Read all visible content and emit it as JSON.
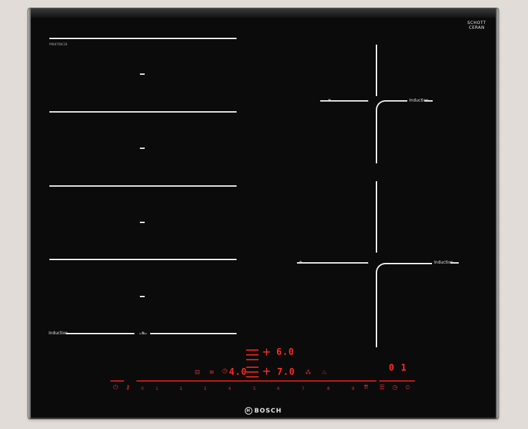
{
  "brand_name": "BOSCH",
  "glass_brand": {
    "line1": "SCHOTT",
    "line2": "CERAN"
  },
  "model_code": "PXE675DC1E",
  "zones": {
    "left_label": "Induction",
    "left_flex_label": "ᴗᴓᴗ",
    "right_top_label": "Induction",
    "right_top_flex": "ᴗᴓᴗ",
    "right_bottom_label": "Induction",
    "right_bottom_flex": "ᴗᴓᴗ"
  },
  "displays": {
    "center_top": "6.0",
    "center_left": "4.0",
    "center_right": "7.0",
    "timer": "0 1"
  },
  "slider": {
    "numbers": [
      "0",
      "1",
      "2",
      "3",
      "4",
      "5",
      "6",
      "7",
      "8",
      "9"
    ]
  },
  "colors": {
    "glass": "#0b0b0c",
    "lines": "#f0f0f0",
    "display_red": "#ff2b1f"
  },
  "icons": [
    "power-icon",
    "child-lock-icon",
    "timer-icon",
    "boost-icon",
    "clock-icon"
  ]
}
